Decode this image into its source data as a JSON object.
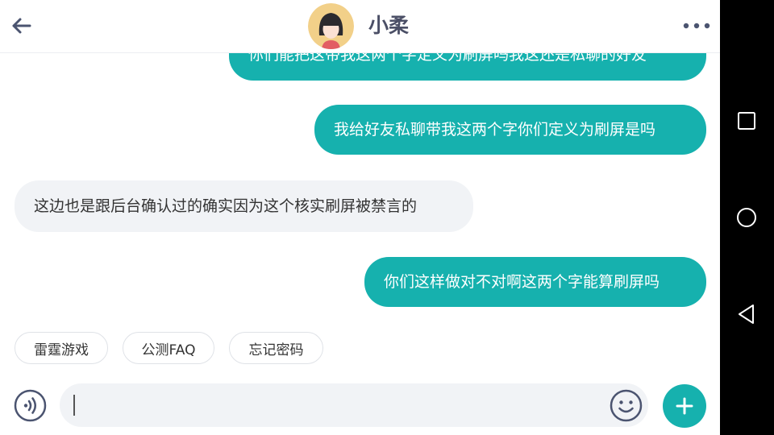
{
  "header": {
    "title": "小柔",
    "back_icon": "arrow-left-icon",
    "more_icon": "more-horizontal-icon"
  },
  "messages": [
    {
      "direction": "out",
      "text": "你们能把这带我这两个字定义为刷屏吗我这还是私聊的好友"
    },
    {
      "direction": "out",
      "text": "我给好友私聊带我这两个字你们定义为刷屏是吗"
    },
    {
      "direction": "in",
      "text": "这边也是跟后台确认过的确实因为这个核实刷屏被禁言的"
    },
    {
      "direction": "out",
      "text": "你们这样做对不对啊这两个字能算刷屏吗"
    }
  ],
  "quick_replies": [
    "雷霆游戏",
    "公测FAQ",
    "忘记密码"
  ],
  "input": {
    "value": "",
    "placeholder": ""
  },
  "colors": {
    "accent": "#16b1ae",
    "incoming_bubble": "#f1f3f6",
    "title": "#4b4f66"
  },
  "icons": {
    "voice": "voice-icon",
    "emoji": "emoji-icon",
    "plus": "plus-icon",
    "nav_recent": "square-icon",
    "nav_home": "circle-icon",
    "nav_back": "triangle-back-icon"
  }
}
